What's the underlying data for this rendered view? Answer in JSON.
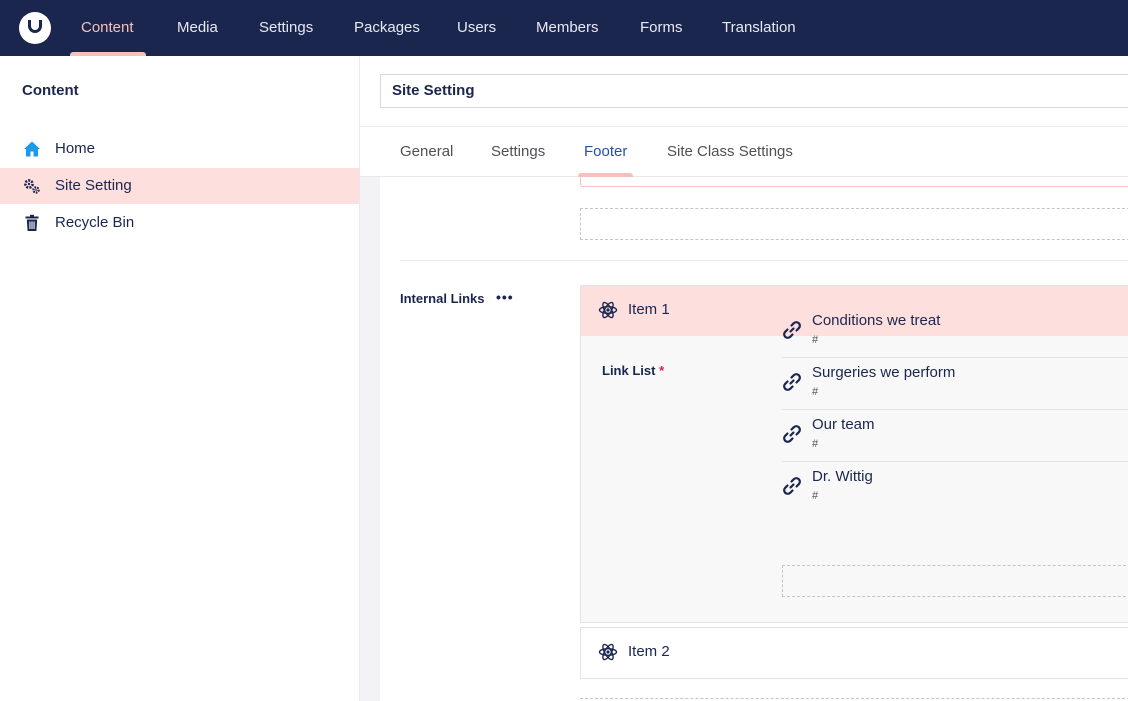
{
  "header": {
    "logo_icon": "umbraco-logo-icon",
    "sections": [
      {
        "label": "Content",
        "active": true
      },
      {
        "label": "Media"
      },
      {
        "label": "Settings"
      },
      {
        "label": "Packages"
      },
      {
        "label": "Users"
      },
      {
        "label": "Members"
      },
      {
        "label": "Forms"
      },
      {
        "label": "Translation"
      }
    ]
  },
  "sidebar": {
    "title": "Content",
    "items": [
      {
        "label": "Home",
        "icon": "home-icon"
      },
      {
        "label": "Site Setting",
        "icon": "settings-gears-icon",
        "selected": true
      },
      {
        "label": "Recycle Bin",
        "icon": "trash-icon"
      }
    ]
  },
  "editor": {
    "node_name": "Site Setting",
    "tabs": [
      {
        "label": "General"
      },
      {
        "label": "Settings"
      },
      {
        "label": "Footer",
        "active": true
      },
      {
        "label": "Site Class Settings"
      }
    ],
    "property": {
      "label": "Internal Links",
      "actions_icon": "more-dots-icon",
      "more_label": "•••"
    },
    "blocks": [
      {
        "label": "Item 1",
        "icon": "atom-icon",
        "expanded": true,
        "link_list": {
          "label": "Link List",
          "required_marker": "*",
          "links": [
            {
              "name": "Conditions we treat",
              "url": "#"
            },
            {
              "name": "Surgeries we perform",
              "url": "#"
            },
            {
              "name": "Our team",
              "url": "#"
            },
            {
              "name": "Dr. Wittig",
              "url": "#"
            }
          ]
        }
      },
      {
        "label": "Item 2",
        "icon": "atom-icon",
        "expanded": false
      }
    ]
  },
  "colors": {
    "header_bg": "#1b264f",
    "active_accent": "#f5c1bc",
    "selected_bg": "#fde0de",
    "active_tab": "#2152a3",
    "home_icon": "#1b9aec"
  }
}
